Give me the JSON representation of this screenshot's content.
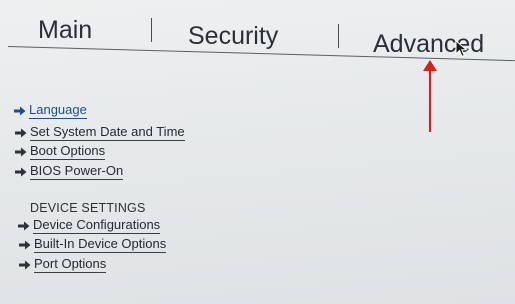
{
  "tabs": {
    "main": "Main",
    "security": "Security",
    "advanced": "Advanced"
  },
  "menu": {
    "items": [
      {
        "label": "Language",
        "selected": true
      },
      {
        "label": "Set System Date and Time"
      },
      {
        "label": "Boot Options"
      },
      {
        "label": "BIOS Power-On"
      }
    ],
    "device_settings_heading": "DEVICE SETTINGS",
    "device_items": [
      {
        "label": "Device Configurations"
      },
      {
        "label": "Built-In Device Options"
      },
      {
        "label": "Port Options"
      }
    ]
  },
  "colors": {
    "accent": "#1a4f8c",
    "annotation_arrow": "#d9211c"
  },
  "icons": {
    "bullet": "right-arrow-icon",
    "pointer": "mouse-pointer-icon",
    "annotation": "red-up-arrow"
  }
}
